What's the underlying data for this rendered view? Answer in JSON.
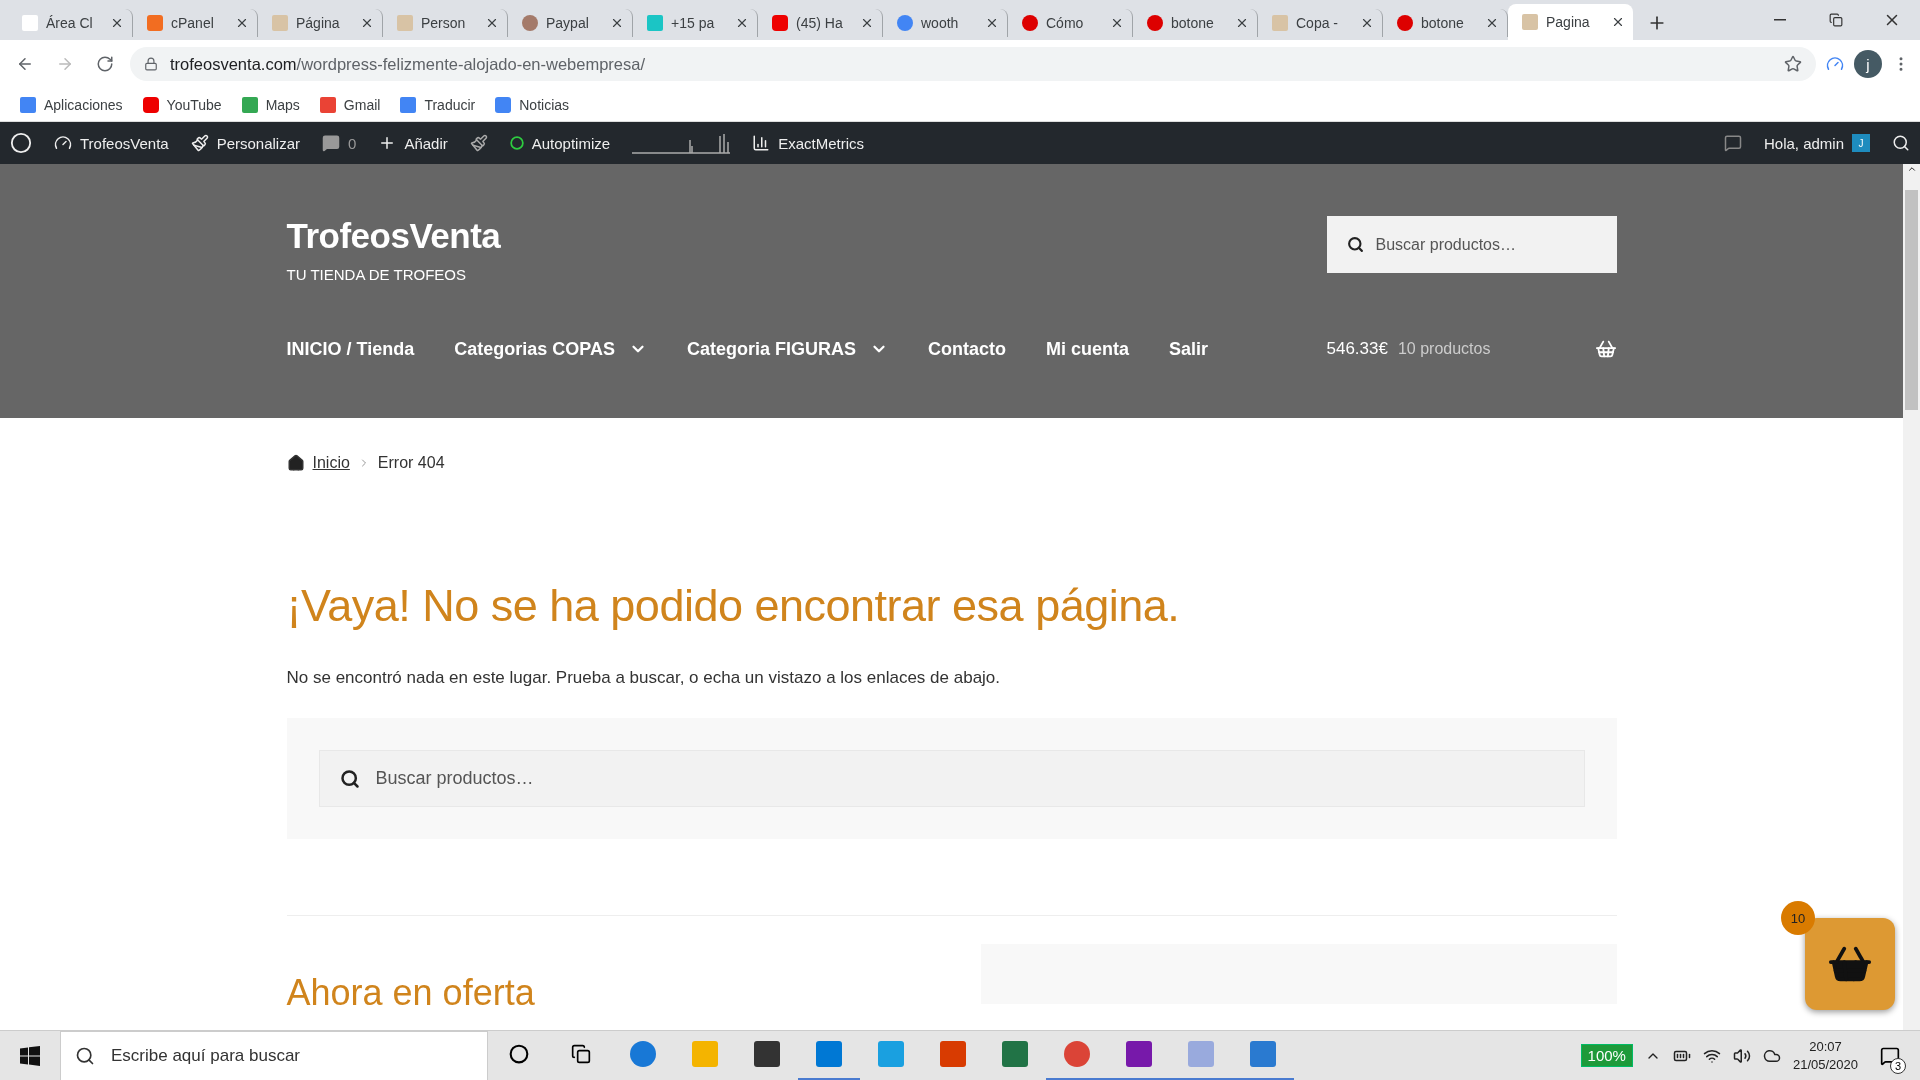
{
  "browser": {
    "tabs": [
      {
        "title": "Área Cl",
        "selected": false
      },
      {
        "title": "cPanel",
        "selected": false
      },
      {
        "title": "Página",
        "selected": false
      },
      {
        "title": "Person",
        "selected": false
      },
      {
        "title": "Paypal",
        "selected": false
      },
      {
        "title": "+15 pa",
        "selected": false
      },
      {
        "title": "(45) Ha",
        "selected": false
      },
      {
        "title": "wooth",
        "selected": false
      },
      {
        "title": "Cómo",
        "selected": false
      },
      {
        "title": "botone",
        "selected": false
      },
      {
        "title": "Copa -",
        "selected": false
      },
      {
        "title": "botone",
        "selected": false
      },
      {
        "title": "Pagina",
        "selected": true
      }
    ],
    "url_host": "trofeosventa.com",
    "url_path": "/wordpress-felizmente-alojado-en-webempresa/",
    "profile": "j",
    "bookmarks": [
      "Aplicaciones",
      "YouTube",
      "Maps",
      "Gmail",
      "Traducir",
      "Noticias"
    ]
  },
  "admin_bar": {
    "site": "TrofeosVenta",
    "customize": "Personalizar",
    "comments": "0",
    "add": "Añadir",
    "autoptimize": "Autoptimize",
    "metrics": "ExactMetrics",
    "greeting": "Hola, admin",
    "avatar": "J"
  },
  "site": {
    "title": "TrofeosVenta",
    "tagline": "TU TIENDA DE TROFEOS",
    "search_placeholder": "Buscar productos…",
    "nav": [
      {
        "label": "INICIO / Tienda",
        "dropdown": false
      },
      {
        "label": "Categorias COPAS",
        "dropdown": true
      },
      {
        "label": "Categoria FIGURAS",
        "dropdown": true
      },
      {
        "label": "Contacto",
        "dropdown": false
      },
      {
        "label": "Mi cuenta",
        "dropdown": false
      },
      {
        "label": "Salir",
        "dropdown": false
      }
    ],
    "cart_total": "546.33€",
    "cart_count": "10 productos"
  },
  "breadcrumb": [
    "Inicio",
    "Error 404"
  ],
  "error": {
    "heading": "¡Vaya! No se ha podido encontrar esa página.",
    "text": "No se encontró nada en este lugar. Prueba a buscar, o echa un vistazo a los enlaces de abajo.",
    "search_placeholder": "Buscar productos…"
  },
  "sale_heading": "Ahora en oferta",
  "floating_cart": {
    "count": "10"
  },
  "taskbar": {
    "search_placeholder": "Escribe aquí para buscar",
    "battery": "100%",
    "time": "20:07",
    "date": "21/05/2020",
    "notifications": "3"
  }
}
